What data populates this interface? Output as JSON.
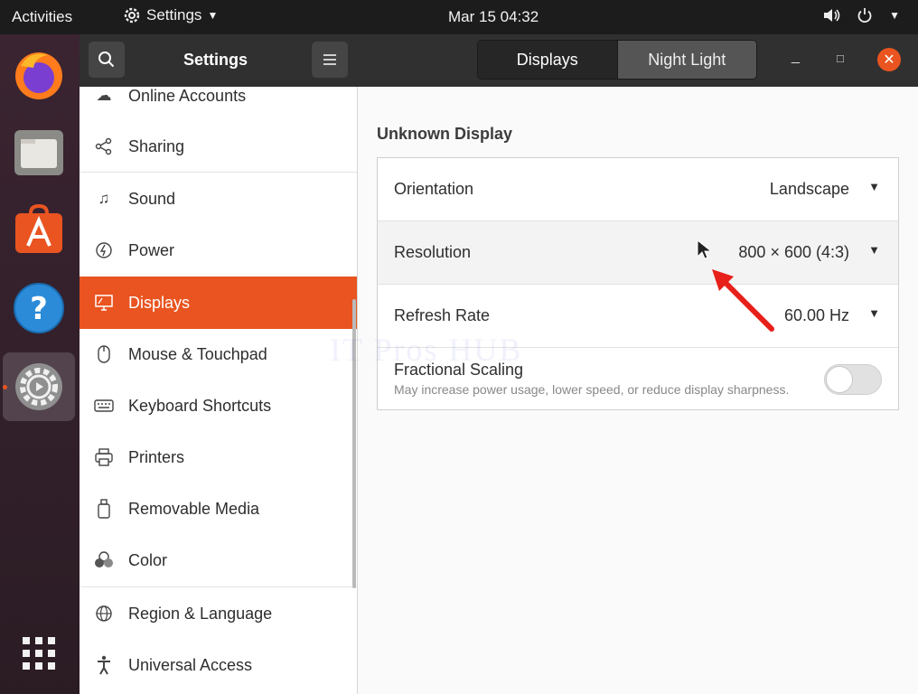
{
  "topbar": {
    "activities": "Activities",
    "app_menu": "Settings",
    "clock": "Mar 15  04:32"
  },
  "dock": {
    "items": [
      {
        "name": "Firefox"
      },
      {
        "name": "Files"
      },
      {
        "name": "Ubuntu Software"
      },
      {
        "name": "Help"
      },
      {
        "name": "Settings"
      }
    ]
  },
  "header": {
    "title": "Settings",
    "tabs": [
      "Displays",
      "Night Light"
    ]
  },
  "sidebar": {
    "items": [
      {
        "label": "Online Accounts",
        "icon": "cloud-icon"
      },
      {
        "label": "Sharing",
        "icon": "share-icon"
      },
      {
        "label": "Sound",
        "icon": "music-note-icon"
      },
      {
        "label": "Power",
        "icon": "power-icon"
      },
      {
        "label": "Displays",
        "icon": "display-icon",
        "selected": true
      },
      {
        "label": "Mouse & Touchpad",
        "icon": "mouse-icon"
      },
      {
        "label": "Keyboard Shortcuts",
        "icon": "keyboard-icon"
      },
      {
        "label": "Printers",
        "icon": "printer-icon"
      },
      {
        "label": "Removable Media",
        "icon": "usb-drive-icon"
      },
      {
        "label": "Color",
        "icon": "color-icon"
      },
      {
        "label": "Region & Language",
        "icon": "globe-icon"
      },
      {
        "label": "Universal Access",
        "icon": "accessibility-icon"
      }
    ]
  },
  "main": {
    "section_title": "Unknown Display",
    "orientation": {
      "label": "Orientation",
      "value": "Landscape"
    },
    "resolution": {
      "label": "Resolution",
      "value": "800 × 600 (4:3)"
    },
    "refresh_rate": {
      "label": "Refresh Rate",
      "value": "60.00 Hz"
    },
    "fractional_scaling": {
      "label": "Fractional Scaling",
      "description": "May increase power usage, lower speed, or reduce display sharpness.",
      "enabled": false
    }
  },
  "watermark": "IT Pros HUB",
  "colors": {
    "accent": "#e95420",
    "headerbar": "#303030",
    "topbar": "#1c1c1c",
    "annotation_arrow": "#e8201a"
  }
}
